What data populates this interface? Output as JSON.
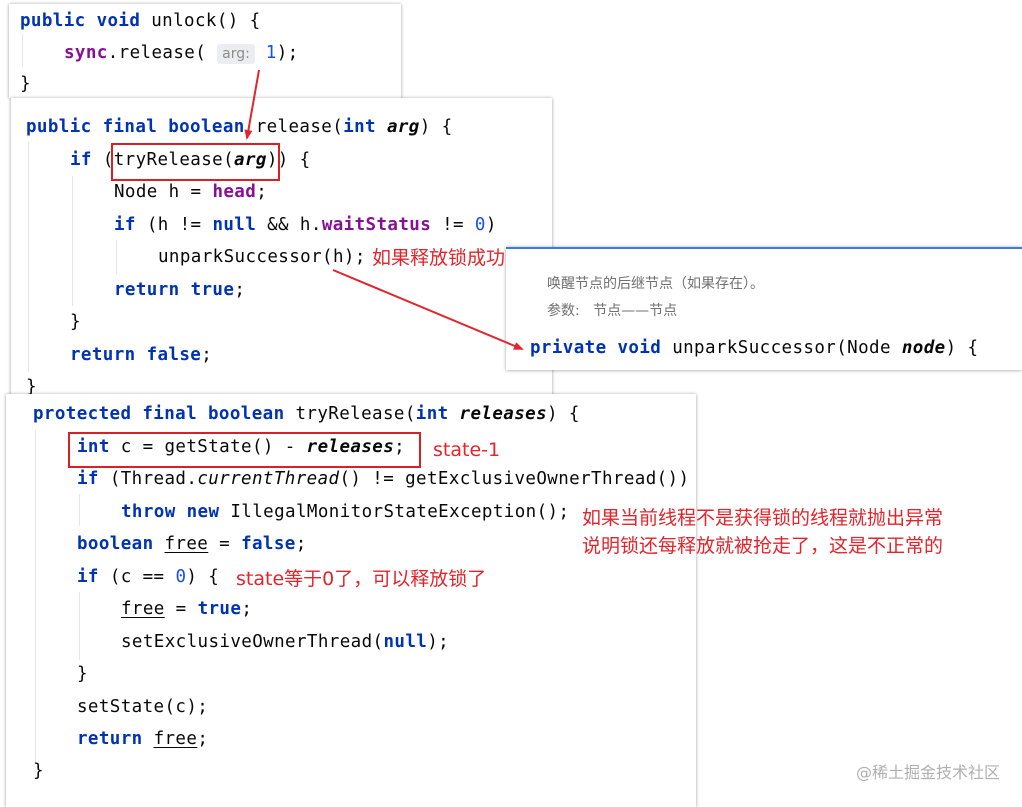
{
  "unlock": {
    "line1": [
      "public",
      "void",
      "unlock() {"
    ],
    "line2_receiver": "sync",
    "line2_call": ".release(",
    "line2_hint": "arg:",
    "line2_arg": "1",
    "line2_end": ");",
    "line3": "}"
  },
  "release": {
    "sig": [
      "public",
      "final",
      "boolean",
      "release(",
      "int",
      "arg",
      ") {"
    ],
    "if1": [
      "if",
      "(tryRelease(",
      "arg",
      ")) {"
    ],
    "node": [
      "Node h = ",
      "head",
      ";"
    ],
    "if2": [
      "if",
      "(h != ",
      "null",
      " && h.",
      "waitStatus",
      " != ",
      "0",
      ")"
    ],
    "unpark": "unparkSuccessor(h);",
    "ret_true": [
      "return",
      "true",
      ";"
    ],
    "close_brace": "}",
    "ret_false": [
      "return",
      "false",
      ";"
    ],
    "end": "}"
  },
  "doc_popup": {
    "desc": "唤醒节点的后继节点（如果存在）。",
    "params_label": "参数:",
    "params_value": "节点——节点",
    "sig": [
      "private",
      "void",
      "unparkSuccessor(Node ",
      "node",
      ") {"
    ]
  },
  "try_release": {
    "sig": [
      "protected",
      "final",
      "boolean",
      "tryRelease(",
      "int",
      "releases",
      ") {"
    ],
    "line_c": [
      "int",
      "c = getState() - ",
      "releases",
      ";"
    ],
    "if_thread": [
      "if",
      "(Thread.",
      "currentThread",
      "() != getExclusiveOwnerThread())"
    ],
    "throw": [
      "throw",
      "new",
      "IllegalMonitorStateException();"
    ],
    "bool_free": [
      "boolean",
      "free",
      " = ",
      "false",
      ";"
    ],
    "if_c": [
      "if",
      "(c == ",
      "0",
      ") {"
    ],
    "free_true": [
      "free",
      " = ",
      "true",
      ";"
    ],
    "set_owner": [
      "setExclusiveOwnerThread(",
      "null",
      ");"
    ],
    "close_brace": "}",
    "set_state": "setState(c);",
    "ret_free": [
      "return",
      "free",
      ";"
    ],
    "end": "}"
  },
  "annotations": {
    "release_success": "如果释放锁成功",
    "state_minus": "state-1",
    "throw_note_1": "如果当前线程不是获得锁的线程就抛出异常",
    "throw_note_2": "说明锁还每释放就被抢走了，这是不正常的",
    "state_zero": "state等于0了，可以释放锁了"
  },
  "watermark": "@稀土掘金技术社区",
  "colors": {
    "keyword": "#0033b3",
    "field": "#871094",
    "number": "#1750eb",
    "annotation": "#e3242b"
  }
}
